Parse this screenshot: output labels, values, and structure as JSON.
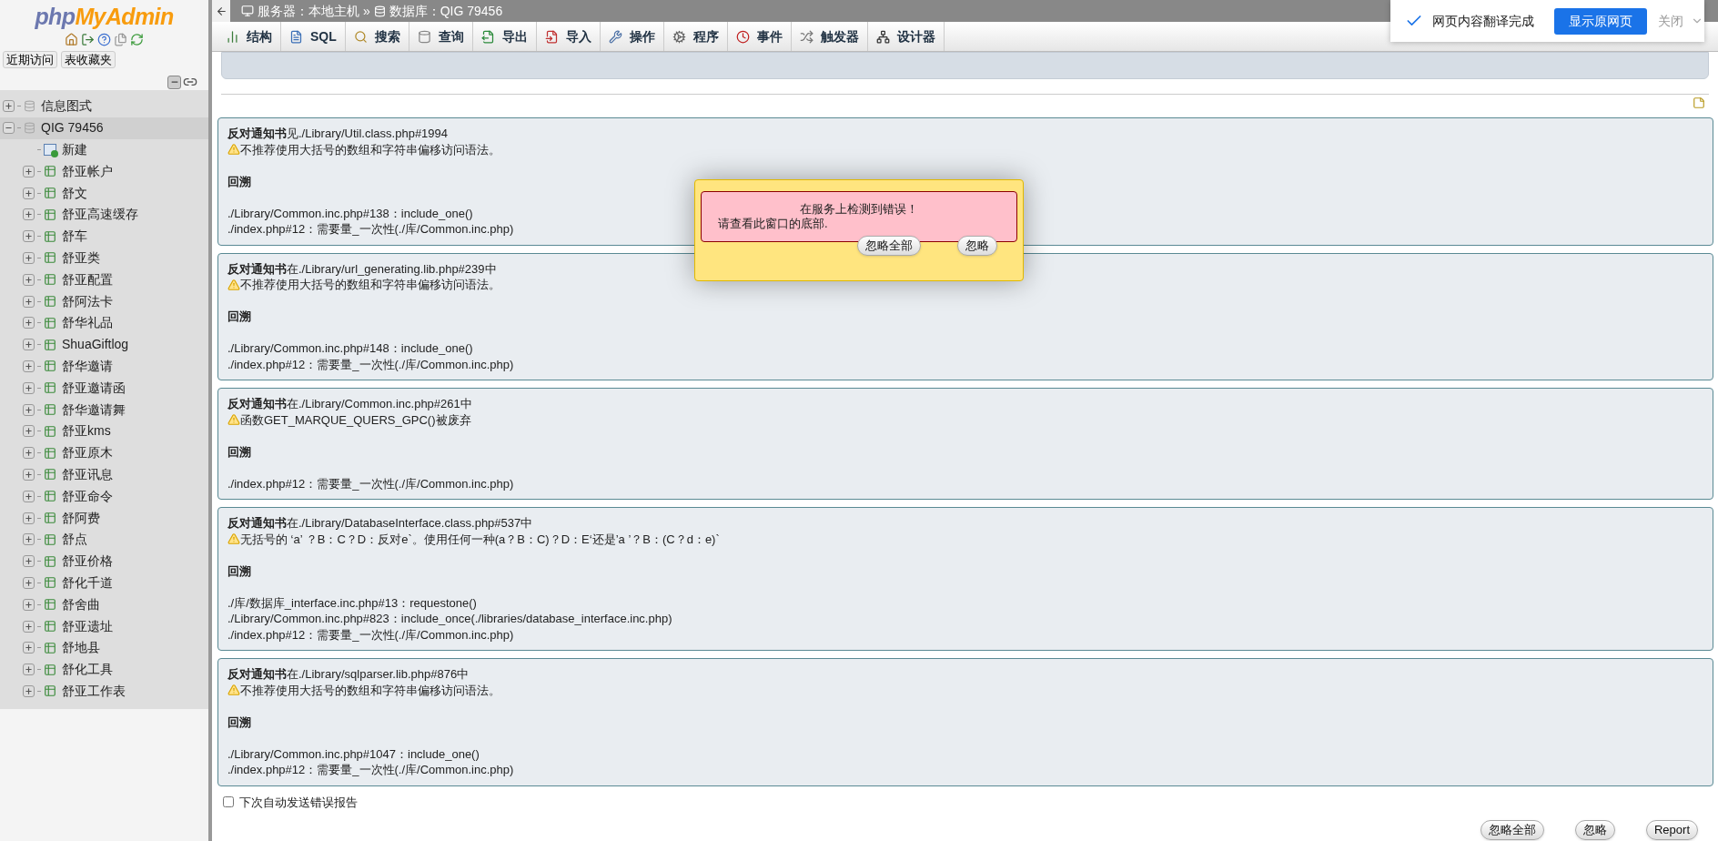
{
  "sidebar": {
    "logo": {
      "php": "php",
      "name": "MyAdmin"
    },
    "tabs": [
      {
        "label": "近期访问"
      },
      {
        "label": "表收藏夹"
      }
    ],
    "tree": [
      {
        "label": "信息图式",
        "kind": "database",
        "expanded": false,
        "selected": false
      },
      {
        "label": "QIG 79456",
        "kind": "database",
        "expanded": true,
        "selected": true,
        "children": [
          {
            "label": "新建",
            "kind": "new"
          },
          {
            "label": "舒亚帐户",
            "kind": "table"
          },
          {
            "label": "舒文",
            "kind": "table"
          },
          {
            "label": "舒亚高速缓存",
            "kind": "table"
          },
          {
            "label": "舒车",
            "kind": "table"
          },
          {
            "label": "舒亚类",
            "kind": "table"
          },
          {
            "label": "舒亚配置",
            "kind": "table"
          },
          {
            "label": "舒阿法卡",
            "kind": "table"
          },
          {
            "label": "舒华礼品",
            "kind": "table"
          },
          {
            "label": "ShuaGiftlog",
            "kind": "table"
          },
          {
            "label": "舒华邀请",
            "kind": "table"
          },
          {
            "label": "舒亚邀请函",
            "kind": "table"
          },
          {
            "label": "舒华邀请舞",
            "kind": "table"
          },
          {
            "label": "舒亚kms",
            "kind": "table"
          },
          {
            "label": "舒亚原木",
            "kind": "table"
          },
          {
            "label": "舒亚讯息",
            "kind": "table"
          },
          {
            "label": "舒亚命令",
            "kind": "table"
          },
          {
            "label": "舒阿费",
            "kind": "table"
          },
          {
            "label": "舒点",
            "kind": "table"
          },
          {
            "label": "舒亚价格",
            "kind": "table"
          },
          {
            "label": "舒化千道",
            "kind": "table"
          },
          {
            "label": "舒舍曲",
            "kind": "table"
          },
          {
            "label": "舒亚遗址",
            "kind": "table"
          },
          {
            "label": "舒地县",
            "kind": "table"
          },
          {
            "label": "舒化工具",
            "kind": "table"
          },
          {
            "label": "舒亚工作表",
            "kind": "table"
          }
        ]
      }
    ]
  },
  "breadcrumb": [
    "服务器：本地主机 »",
    "数据库：QIG 79456"
  ],
  "tabs": [
    {
      "label": "结构"
    },
    {
      "label": "SQL"
    },
    {
      "label": "搜索"
    },
    {
      "label": "查询"
    },
    {
      "label": "导出"
    },
    {
      "label": "导入"
    },
    {
      "label": "操作"
    },
    {
      "label": "程序"
    },
    {
      "label": "事件"
    },
    {
      "label": "触发器"
    },
    {
      "label": "设计器"
    }
  ],
  "notices": [
    {
      "heading": "**反对通知书**见./Library/Util.class.php#1994",
      "message": "不推荐使用大括号的数组和字符串偏移访问语法。",
      "backtrace_title": "回溯",
      "backtrace": [
        "./Library/Common.inc.php#138：include_one()",
        "./index.php#12：需要量_一次性(./库/Common.inc.php)"
      ]
    },
    {
      "heading": "**反对通知书**在./Library/url_generating.lib.php#239中",
      "message": "不推荐使用大括号的数组和字符串偏移访问语法。",
      "backtrace_title": "回溯",
      "backtrace": [
        "./Library/Common.inc.php#148：include_one()",
        "./index.php#12：需要量_一次性(./库/Common.inc.php)"
      ]
    },
    {
      "heading": "**反对通知书**在./Library/Common.inc.php#261中",
      "message": "函数GET_MARQUE_QUERS_GPC()被废弃",
      "backtrace_title": "回溯",
      "backtrace": [
        "./index.php#12：需要量_一次性(./库/Common.inc.php)"
      ]
    },
    {
      "heading": "**反对通知书**在./Library/DatabaseInterface.class.php#537中",
      "message": "无括号的 ‘a’ ？B：C？D：反对e`。使用任何一种(a？B：C)？D：E‘还是’a ’？B：(C？d：e)`",
      "backtrace_title": "回溯",
      "backtrace": [
        "./库/数据库_interface.inc.php#13：requestone()",
        "./Library/Common.inc.php#823：include_once(./libraries/database_interface.inc.php)",
        "./index.php#12：需要量_一次性(./库/Common.inc.php)"
      ]
    },
    {
      "heading": "**反对通知书**在./Library/sqlparser.lib.php#876中",
      "message": "不推荐使用大括号的数组和字符串偏移访问语法。",
      "backtrace_title": "回溯",
      "backtrace": [
        "./Library/Common.inc.php#1047：include_one()",
        "./index.php#12：需要量_一次性(./库/Common.inc.php)"
      ]
    }
  ],
  "auto_send": {
    "label": "下次自动发送错误报告",
    "checked": false
  },
  "footer_buttons": [
    "忽略全部",
    "忽略",
    "Report"
  ],
  "error_popup": {
    "title": "在服务上检测到错误！",
    "message": "请查看此窗口的底部.",
    "buttons": [
      "忽略全部",
      "忽略"
    ]
  },
  "translate_bar": {
    "message": "网页内容翻译完成",
    "show_original": "显示原网页",
    "close": "关闭"
  }
}
